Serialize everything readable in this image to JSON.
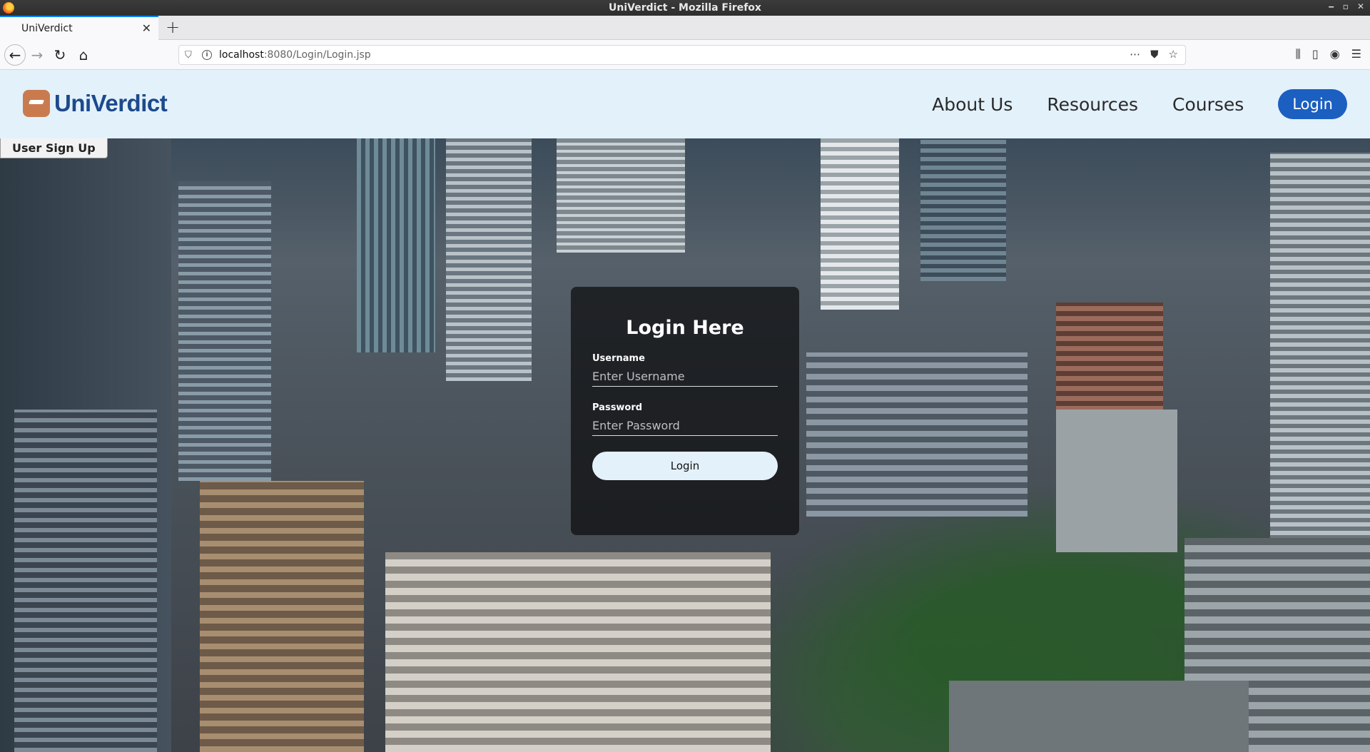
{
  "browser": {
    "window_title": "UniVerdict - Mozilla Firefox",
    "tab_title": "UniVerdict",
    "url_host": "localhost",
    "url_path": ":8080/Login/Login.jsp"
  },
  "header": {
    "logo_text": "UniVerdict",
    "nav": [
      "About Us",
      "Resources",
      "Courses"
    ],
    "login_label": "Login"
  },
  "signup_label": "User Sign Up",
  "login_form": {
    "title": "Login Here",
    "username_label": "Username",
    "username_placeholder": "Enter Username",
    "password_label": "Password",
    "password_placeholder": "Enter Password",
    "submit_label": "Login"
  },
  "colors": {
    "header_bg": "#e3f1fb",
    "brand_blue": "#1b5fc1",
    "logo_orange": "#c97b4f"
  }
}
